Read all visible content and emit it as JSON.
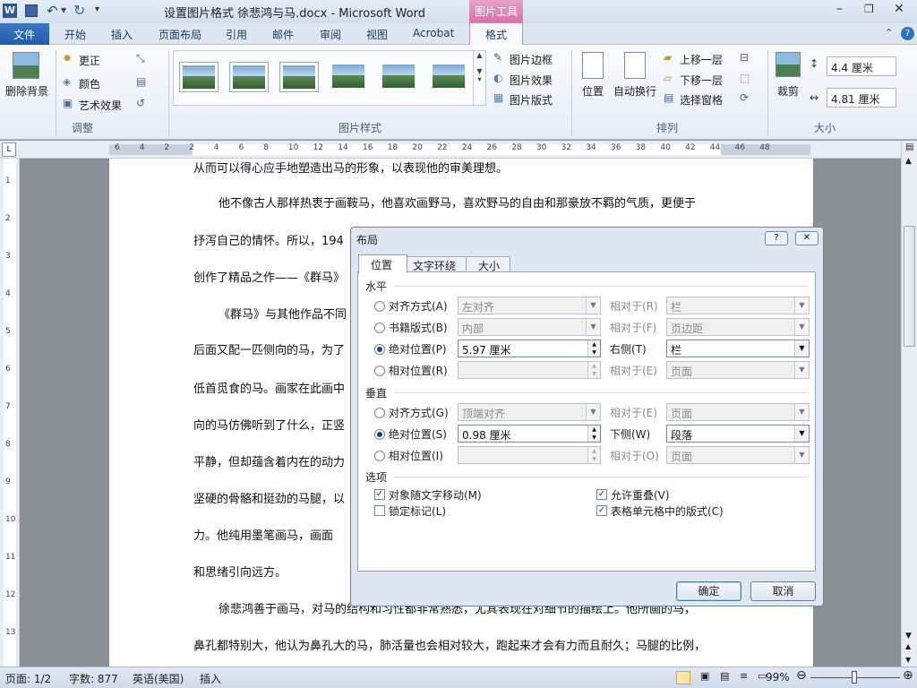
{
  "title_bar": {
    "title": "设置图片格式 徐悲鸿与马.docx - Microsoft Word",
    "contextual_tab": "图片工具"
  },
  "tabs": [
    "文件",
    "开始",
    "插入",
    "页面布局",
    "引用",
    "邮件",
    "审阅",
    "视图",
    "Acrobat",
    "格式"
  ],
  "ribbon": {
    "remove_bg": "删除背景",
    "adjust": {
      "corrections": "更正",
      "color": "颜色",
      "artistic": "艺术效果",
      "group": "调整"
    },
    "styles": {
      "border": "图片边框",
      "effects": "图片效果",
      "layout": "图片版式",
      "group": "图片样式"
    },
    "arrange": {
      "position": "位置",
      "wrap": "自动换行",
      "forward": "上移一层",
      "backward": "下移一层",
      "pane": "选择窗格",
      "group": "排列"
    },
    "size": {
      "crop": "裁剪",
      "height": "4.4 厘米",
      "width": "4.81 厘米",
      "group": "大小"
    }
  },
  "ruler": [
    "6",
    "4",
    "2",
    "2",
    "4",
    "6",
    "8",
    "10",
    "12",
    "14",
    "16",
    "18",
    "20",
    "22",
    "24",
    "26",
    "28",
    "30",
    "32",
    "34",
    "36",
    "38",
    "40",
    "42",
    "44",
    "46",
    "48"
  ],
  "vruler": [
    "1",
    "2",
    "3",
    "4",
    "5",
    "6",
    "7",
    "8",
    "9",
    "10",
    "11",
    "12",
    "13"
  ],
  "doc": {
    "lines": [
      "从而可以得心应手地塑造出马的形象，以表现他的审美理想。",
      "他不像古人那样热衷于画鞍马，他喜欢画野马，喜欢野马的自由和那豪放不羁的气质，更便于",
      "抒泻自己的情怀。所以，194",
      "创作了精品之作——《群马》",
      "《群马》与其他作品不同",
      "后面又配一匹侧向的马，为了",
      "低首觅食的马。画家在此画中",
      "向的马仿佛听到了什么，正竖",
      "平静，但却蕴含着内在的动力",
      "坚硬的骨骼和挺劲的马腿，以",
      "力。他纯用墨笔画马，画面",
      "和思绪引向远方。",
      "徐悲鸿善于画马，对马的结构和习性都非常熟悉，尤其表现在对细节的描绘上。他所画的马，",
      "鼻孔都特别大，他认为鼻孔大的马，肺活量也会相对较大，跑起来才会有力而且耐久；马腿的比例，"
    ]
  },
  "dialog": {
    "title": "布局",
    "tabs": [
      "位置",
      "文字环绕",
      "大小"
    ],
    "horizontal": "水平",
    "h_rows": [
      {
        "label": "对齐方式(A)",
        "value": "左对齐",
        "rel_label": "相对于(R)",
        "rel": "栏"
      },
      {
        "label": "书籍版式(B)",
        "value": "内部",
        "rel_label": "相对于(F)",
        "rel": "页边距"
      },
      {
        "label": "绝对位置(P)",
        "value": "5.97 厘米",
        "rel_label": "右侧(T)",
        "rel": "栏"
      },
      {
        "label": "相对位置(R)",
        "value": "",
        "rel_label": "相对于(E)",
        "rel": "页面"
      }
    ],
    "vertical": "垂直",
    "v_rows": [
      {
        "label": "对齐方式(G)",
        "value": "顶端对齐",
        "rel_label": "相对于(E)",
        "rel": "页面"
      },
      {
        "label": "绝对位置(S)",
        "value": "0.98 厘米",
        "rel_label": "下侧(W)",
        "rel": "段落"
      },
      {
        "label": "相对位置(I)",
        "value": "",
        "rel_label": "相对于(O)",
        "rel": "页面"
      }
    ],
    "options": "选项",
    "opt": [
      "对象随文字移动(M)",
      "锁定标记(L)",
      "允许重叠(V)",
      "表格单元格中的版式(C)"
    ],
    "ok": "确定",
    "cancel": "取消"
  },
  "status": {
    "page": "页面: 1/2",
    "words": "字数: 877",
    "lang": "英语(美国)",
    "mode": "插入",
    "zoom": "99%"
  }
}
